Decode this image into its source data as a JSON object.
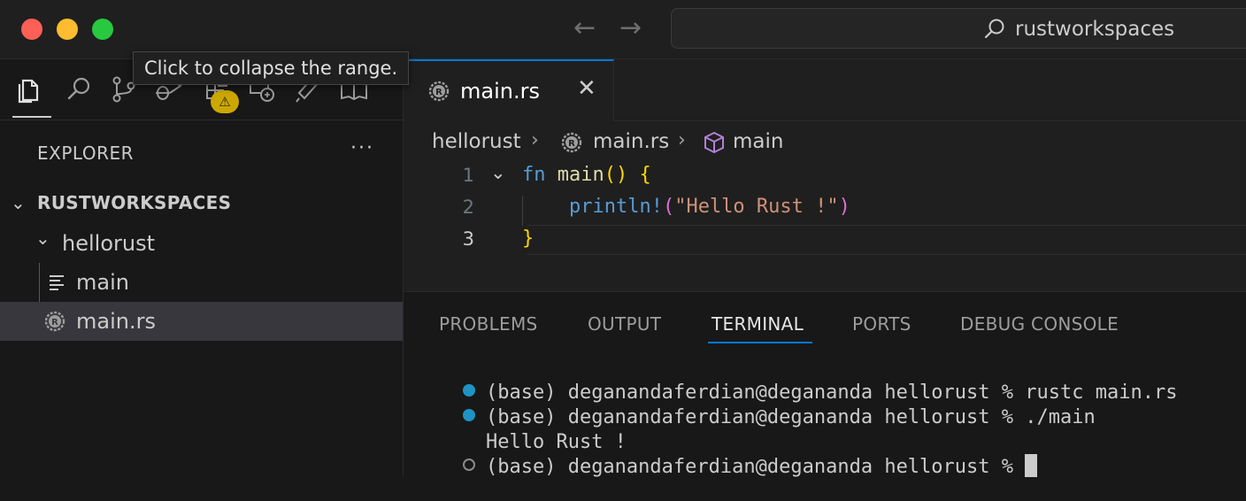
{
  "window": {
    "search_text": "rustworkspaces"
  },
  "tooltip": {
    "text": "Click to collapse the range."
  },
  "activity_bar": {
    "items": [
      "files-icon",
      "search-icon",
      "source-control-icon",
      "run-debug-icon",
      "extensions-icon",
      "remote-explorer-icon",
      "testing-icon",
      "book-icon"
    ],
    "warning_badge": "⚠"
  },
  "explorer": {
    "title": "EXPLORER",
    "more": "···",
    "workspace": "RUSTWORKSPACES",
    "folder": "hellorust",
    "files": [
      {
        "name": "main",
        "icon": "file-lines-icon"
      },
      {
        "name": "main.rs",
        "icon": "rust-icon",
        "selected": true
      }
    ]
  },
  "editor": {
    "tab_label": "main.rs",
    "tab_close": "✕",
    "breadcrumb": {
      "folder": "hellorust",
      "file": "main.rs",
      "symbol": "main"
    },
    "lines": [
      {
        "number": "1",
        "fold": "⌄",
        "tokens": [
          {
            "t": "fn",
            "c": "kw"
          },
          {
            "t": " ",
            "c": "plain"
          },
          {
            "t": "main",
            "c": "fnc"
          },
          {
            "t": "()",
            "c": "br"
          },
          {
            "t": " ",
            "c": "plain"
          },
          {
            "t": "{",
            "c": "br"
          }
        ]
      },
      {
        "number": "2",
        "fold": "",
        "tokens": [
          {
            "t": "    ",
            "c": "plain"
          },
          {
            "t": "println!",
            "c": "mac"
          },
          {
            "t": "(",
            "c": "br2"
          },
          {
            "t": "\"Hello Rust !\"",
            "c": "str"
          },
          {
            "t": ")",
            "c": "br2"
          }
        ]
      },
      {
        "number": "3",
        "fold": "",
        "tokens": [
          {
            "t": "}",
            "c": "br"
          }
        ]
      }
    ]
  },
  "panel": {
    "tabs": [
      "PROBLEMS",
      "OUTPUT",
      "TERMINAL",
      "PORTS",
      "DEBUG CONSOLE"
    ],
    "active_tab": "TERMINAL",
    "terminal": {
      "line1": "(base) deganandaferdian@degananda hellorust % rustc main.rs",
      "line2": "(base) deganandaferdian@degananda hellorust % ./main",
      "output": "Hello Rust !",
      "prompt": "(base) deganandaferdian@degananda hellorust % "
    }
  },
  "colors": {
    "accent": "#0078d4",
    "badge": "#cca700",
    "terminal_dot_success": "#1e93c6"
  }
}
